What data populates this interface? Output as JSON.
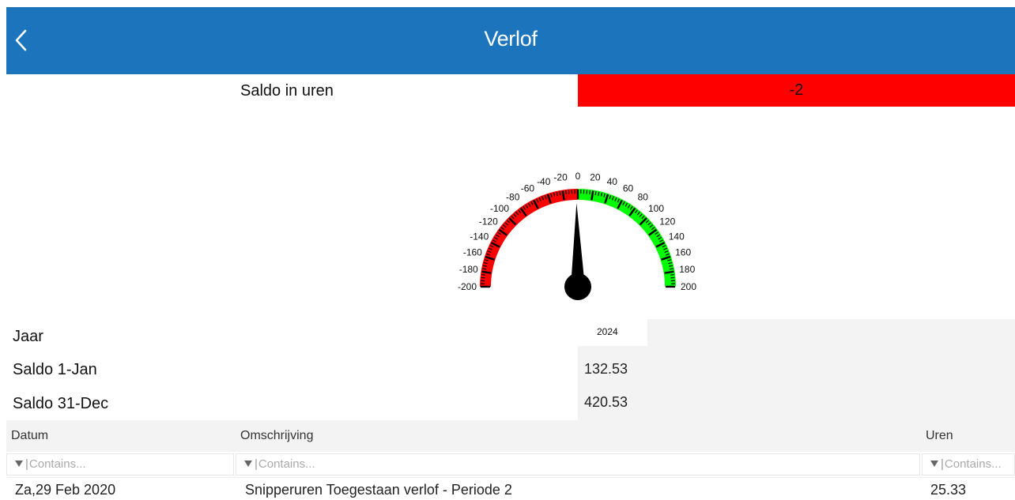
{
  "header": {
    "title": "Verlof",
    "back_icon": "chevron-left-icon",
    "background": "#1c75bc"
  },
  "saldo": {
    "label": "Saldo in uren",
    "value": "-2",
    "value_color": "#ff0000"
  },
  "gauge": {
    "min": -200,
    "max": 200,
    "value": -2,
    "tick_labels": [
      "-200",
      "-180",
      "-160",
      "-140",
      "-120",
      "-100",
      "-80",
      "-60",
      "-40",
      "-20",
      "0",
      "20",
      "40",
      "60",
      "80",
      "100",
      "120",
      "140",
      "160",
      "180",
      "200"
    ],
    "negative_color": "#ff0000",
    "positive_color": "#00ff00",
    "needle_color": "#000000"
  },
  "info": {
    "year_label": "Jaar",
    "year_value": "2024",
    "saldo_start_label": "Saldo 1-Jan",
    "saldo_start_value": "132.53",
    "saldo_end_label": "Saldo 31-Dec",
    "saldo_end_value": "420.53"
  },
  "grid": {
    "columns": [
      "Datum",
      "Omschrijving",
      "Uren"
    ],
    "filter_placeholder": "Contains...",
    "filter_icon": "filter-icon",
    "rows": [
      [
        "Za,29 Feb 2020",
        "Snipperuren Toegestaan verlof - Periode 2",
        "25.33"
      ]
    ]
  }
}
